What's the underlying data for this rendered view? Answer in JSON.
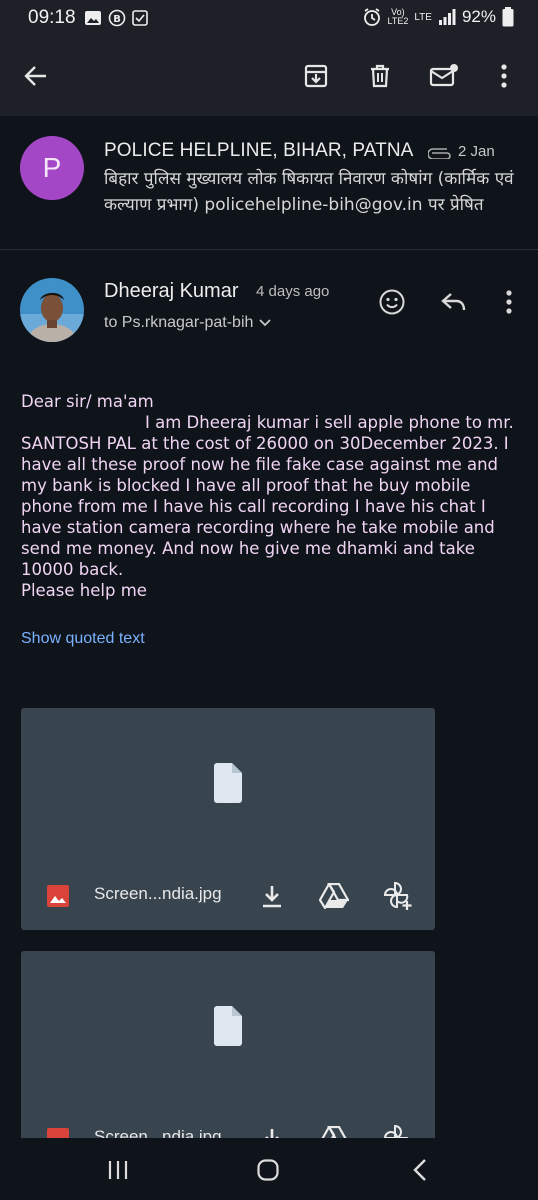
{
  "status_bar": {
    "time": "09:18",
    "left_icons": [
      "image-icon",
      "b-icon",
      "checklist-icon"
    ],
    "volte": "Vo)\nLTE2",
    "network": "LTE",
    "battery": "92%"
  },
  "toolbar": {
    "back_icon": "arrow-left-icon",
    "actions": [
      "archive-icon",
      "trash-icon",
      "mark-unread-icon",
      "more-vert-icon"
    ]
  },
  "sender": {
    "avatar_letter": "P",
    "avatar_color": "#a447c7",
    "name": "POLICE HELPLINE, BIHAR, PATNA",
    "date": "2 Jan",
    "description": "बिहार पुलिस मुख्यालय लोक षिकायत निवारण कोषांग (कार्मिक एवं कल्याण प्रभाग) policehelpline-bih@gov.in पर प्रेषित"
  },
  "message": {
    "from": "Dheeraj Kumar",
    "time_ago": "4 days ago",
    "to": "to Ps.rknagar-pat-bih",
    "greeting": "Dear sir/ ma'am",
    "body": "I am Dheeraj kumar i sell apple phone to mr. SANTOSH PAL at the cost of 26000 on 30December 2023. I have all these proof now he file fake case against me and my bank is blocked I have all proof that he buy mobile phone from me I have his call recording I have his chat I have station camera recording where he take mobile and send me money. And now he give me dhamki and take 10000 back.",
    "closing": "Please help me",
    "show_quoted": "Show quoted text",
    "body_color": "#f0d4f3",
    "link_color": "#7ab1ff"
  },
  "attachments": [
    {
      "filename": "Screen...ndia.jpg"
    },
    {
      "filename": "Screen...ndia.jpg"
    }
  ],
  "nav": [
    "recents-icon",
    "home-icon",
    "back-icon"
  ]
}
